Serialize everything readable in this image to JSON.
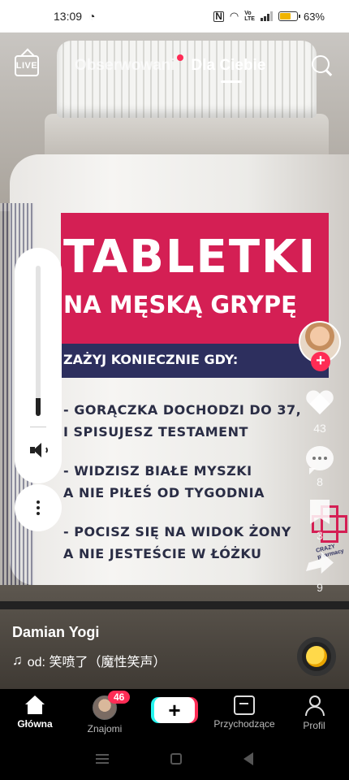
{
  "status": {
    "time": "13:09",
    "battery_percent": "63%",
    "battery_level": 0.63
  },
  "top_nav": {
    "live_label": "LIVE",
    "tab_following": "Obserwowani",
    "tab_for_you": "Dla Ciebie"
  },
  "video_image_text": {
    "title": "TABLETKI",
    "subtitle": "NA MĘSKĄ GRYPĘ",
    "banner": "ZAŻYJ KONIECZNIE GDY:",
    "line1": "- GORĄCZKA DOCHODZI DO 37,",
    "line2": "I SPISUJESZ TESTAMENT",
    "line3": "- WIDZISZ BIAŁE MYSZKI",
    "line4": "A NIE PIŁEŚ OD TYGODNIA",
    "line5": "- POCISZ SIĘ NA WIDOK ŻONY",
    "line6": "A NIE JESTEŚCIE W ŁÓŻKU",
    "brand": "CRAZY pharmacy"
  },
  "volume": {
    "level": 0.12
  },
  "rail": {
    "follow_symbol": "+",
    "likes": "43",
    "comments": "8",
    "saves": "3",
    "shares": "9"
  },
  "caption": {
    "author": "Damian Yogi",
    "music": "od: 笑喷了（魔性笑声）"
  },
  "bottom_nav": {
    "home": "Główna",
    "friends": "Znajomi",
    "friends_badge": "46",
    "create_symbol": "+",
    "inbox": "Przychodzące",
    "profile": "Profil"
  },
  "icons": {
    "live": "live-tv-icon",
    "search": "search-icon",
    "speaker": "speaker-icon",
    "more": "more-vertical-icon",
    "heart": "heart-icon",
    "comment": "comment-icon",
    "bookmark": "bookmark-icon",
    "share": "share-icon",
    "home": "home-icon",
    "inbox": "inbox-icon",
    "profile": "profile-icon"
  },
  "colors": {
    "accent_red": "#fe2c55",
    "accent_cyan": "#25f4ee",
    "label_red": "#d41f54",
    "label_navy": "#2d2f5e"
  }
}
